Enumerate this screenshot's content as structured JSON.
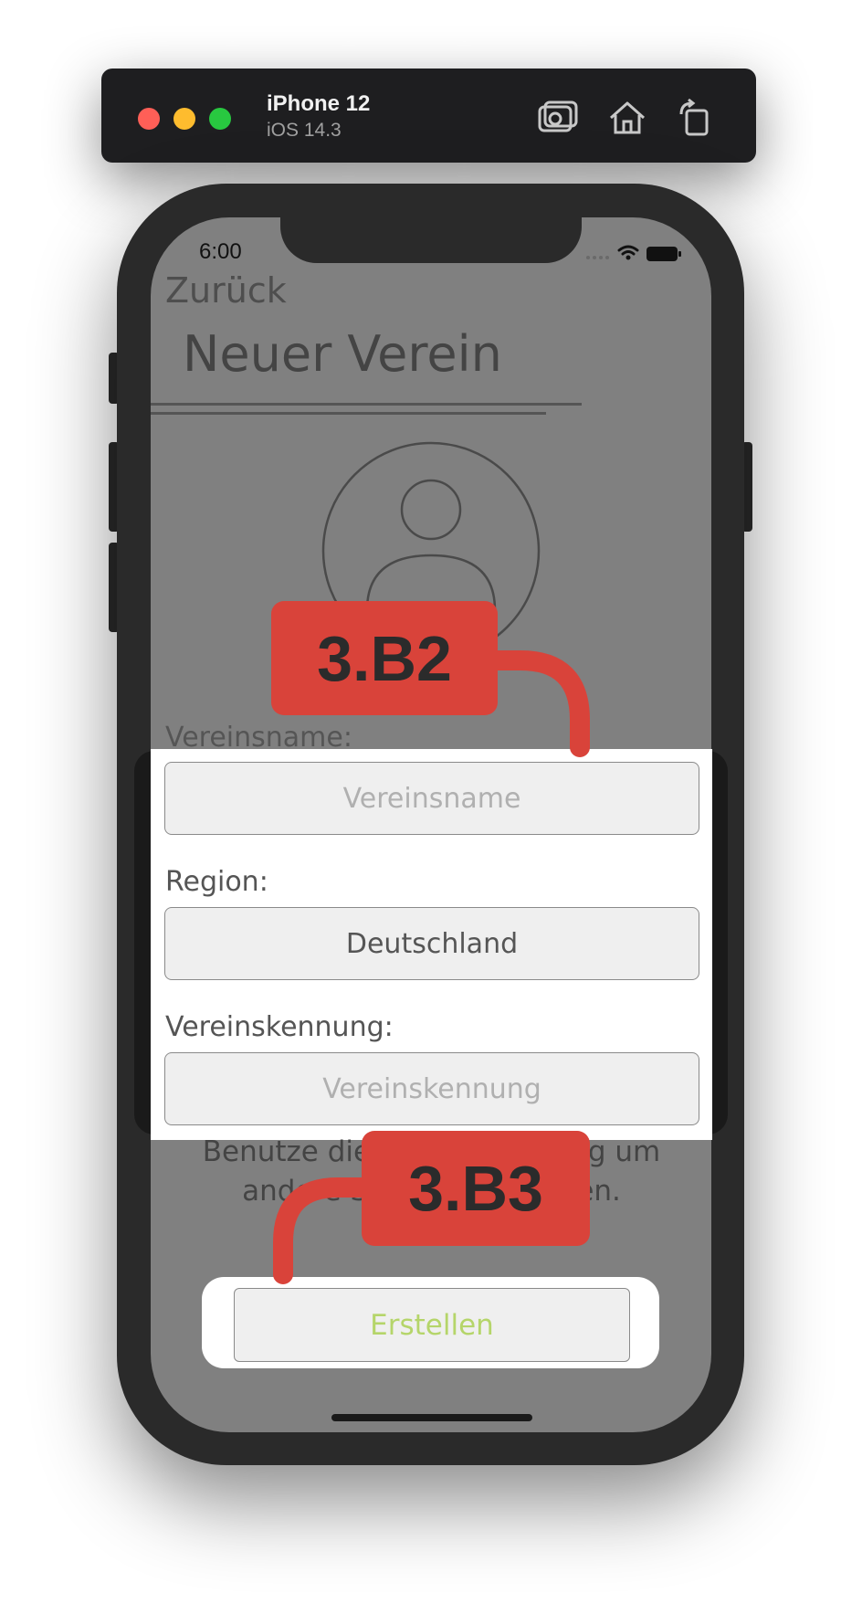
{
  "simulator": {
    "device_name": "iPhone 12",
    "os_version": "iOS 14.3",
    "icons": [
      "screenshot-icon",
      "home-icon",
      "rotate-icon"
    ]
  },
  "status_bar": {
    "time": "6:00"
  },
  "nav": {
    "back_label": "Zurück",
    "title": "Neuer Verein"
  },
  "form": {
    "name_label": "Vereinsname:",
    "name_placeholder": "Vereinsname",
    "region_label": "Region:",
    "region_value": "Deutschland",
    "id_label": "Vereinskennung:",
    "id_placeholder": "Vereinskennung"
  },
  "info": {
    "text": "Benutze die Vereinskennung um andere Spieler einzuladen."
  },
  "actions": {
    "create_label": "Erstellen"
  },
  "annotations": {
    "b2": "3.B2",
    "b3": "3.B3",
    "color": "#d9433a"
  },
  "colors": {
    "dim_overlay": "#808080",
    "create_text": "#b5d56a",
    "placeholder": "#b0b0b0"
  }
}
